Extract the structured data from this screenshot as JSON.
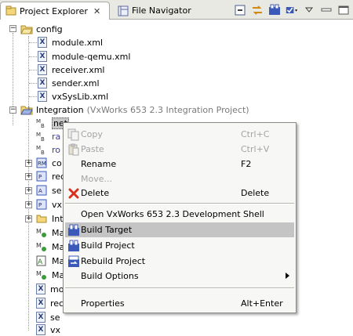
{
  "tabs": {
    "active_label": "Project Explorer",
    "close_glyph": "✕",
    "inactive_label": "File Navigator"
  },
  "tree": {
    "config_folder": "config",
    "config_files": [
      "module.xml",
      "module-qemu.xml",
      "receiver.xml",
      "sender.xml",
      "vxSysLib.xml"
    ],
    "integration_folder": "Integration",
    "integration_suffix": "(VxWorks 653 2.3 Integration Project)",
    "children": [
      "net",
      "ra",
      "ro",
      "co",
      "rec",
      "se",
      "vx",
      "Int",
      "Ma",
      "Ma",
      "Ma",
      "Ma",
      "mo",
      "rec",
      "se",
      "vx"
    ]
  },
  "context_menu": {
    "items": [
      {
        "label": "Copy",
        "shortcut": "Ctrl+C",
        "enabled": false,
        "icon": "copy-icon"
      },
      {
        "label": "Paste",
        "shortcut": "Ctrl+V",
        "enabled": false,
        "icon": "paste-icon"
      },
      {
        "label": "Rename",
        "shortcut": "F2",
        "enabled": true,
        "icon": ""
      },
      {
        "label": "Move...",
        "shortcut": "",
        "enabled": false,
        "icon": ""
      },
      {
        "label": "Delete",
        "shortcut": "Delete",
        "enabled": true,
        "icon": "delete-icon"
      },
      {
        "label": "Open VxWorks 653 2.3 Development Shell",
        "shortcut": "",
        "enabled": true,
        "icon": ""
      },
      {
        "label": "Build Target",
        "shortcut": "",
        "enabled": true,
        "icon": "build-target-icon"
      },
      {
        "label": "Build Project",
        "shortcut": "",
        "enabled": true,
        "icon": "build-project-icon"
      },
      {
        "label": "Rebuild Project",
        "shortcut": "",
        "enabled": true,
        "icon": "rebuild-project-icon"
      },
      {
        "label": "Build Options",
        "shortcut": "",
        "enabled": true,
        "icon": ""
      },
      {
        "label": "Properties",
        "shortcut": "Alt+Enter",
        "enabled": true,
        "icon": ""
      }
    ],
    "hovered_item": "Build Target"
  },
  "colors": {
    "selection": "#c4c4c4",
    "disabled_text": "#a4a4a4",
    "tree_blue_text": "#3d3da0",
    "delete_red": "#d8301f"
  }
}
